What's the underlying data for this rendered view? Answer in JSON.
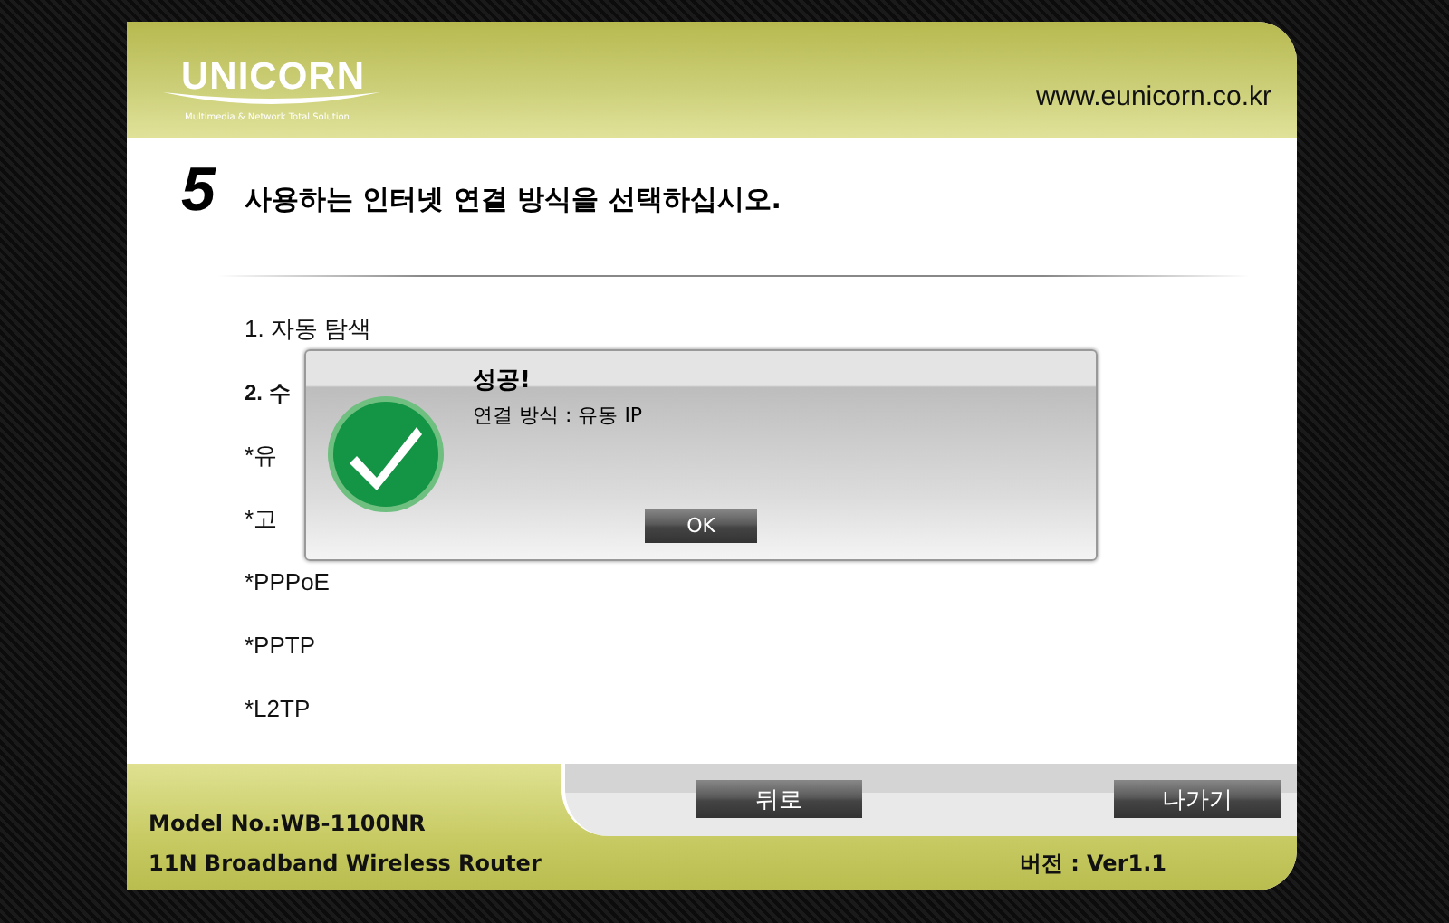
{
  "header": {
    "logo": "UNICORN",
    "tagline": "Multimedia & Network Total Solution",
    "website": "www.eunicorn.co.kr"
  },
  "step": {
    "number": "5",
    "title": "사용하는 인터넷 연결 방식을 선택하십시오."
  },
  "options": [
    {
      "kind": "item",
      "label": "1. 자동 탐색"
    },
    {
      "kind": "heading",
      "label": "2. 수"
    },
    {
      "kind": "item",
      "label": "*유"
    },
    {
      "kind": "item",
      "label": "*고"
    },
    {
      "kind": "item",
      "label": "*PPPoE"
    },
    {
      "kind": "item",
      "label": "*PPTP"
    },
    {
      "kind": "item",
      "label": "*L2TP"
    }
  ],
  "dialog": {
    "title": "성공!",
    "message": "연결 방식 : 유동 IP",
    "button": "OK"
  },
  "footer": {
    "model": "Model No.:WB-1100NR",
    "product": "11N Broadband Wireless Router",
    "version": "버전 : Ver1.1",
    "buttons": [
      "뒤로",
      "나가기"
    ]
  }
}
